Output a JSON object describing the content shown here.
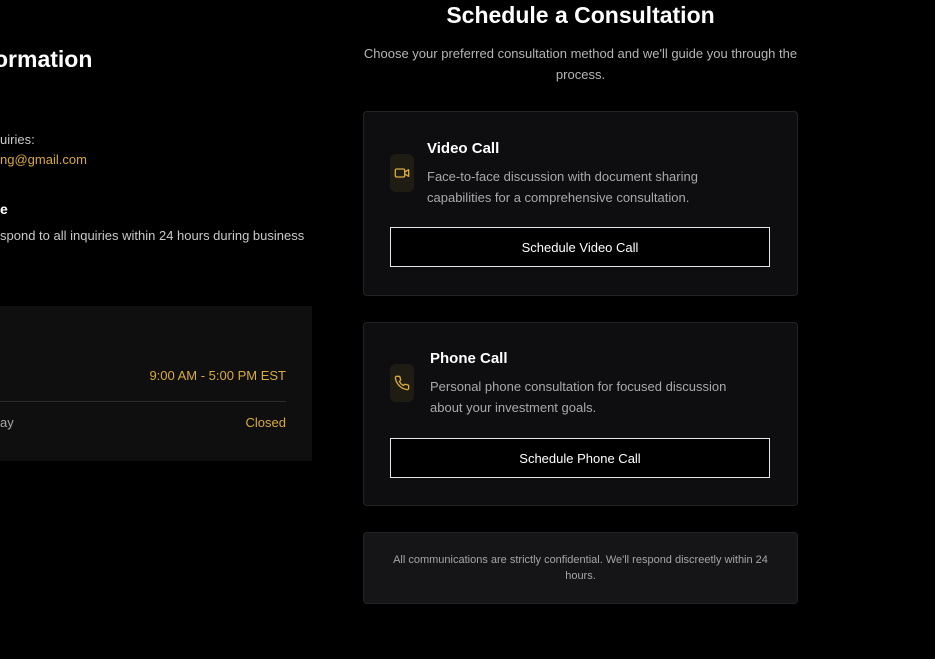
{
  "contact": {
    "title": "ormation",
    "inquiries_label": "uiries:",
    "email": "ng@gmail.com",
    "response_heading": "e",
    "response_text": "spond to all inquiries within 24 hours during business",
    "hours": [
      {
        "day": "",
        "time": "9:00 AM - 5:00 PM EST"
      },
      {
        "day": "ay",
        "time": "Closed"
      }
    ]
  },
  "consultation": {
    "heading": "Schedule a Consultation",
    "subheading": "Choose your preferred consultation method and we'll guide you through the process.",
    "video": {
      "title": "Video Call",
      "description": "Face-to-face discussion with document sharing capabilities for a comprehensive consultation.",
      "button_label": "Schedule Video Call",
      "icon": "video-camera-icon"
    },
    "phone": {
      "title": "Phone Call",
      "description": "Personal phone consultation for focused discussion about your investment goals.",
      "button_label": "Schedule Phone Call",
      "icon": "phone-icon"
    },
    "note": "All communications are strictly confidential. We'll respond discreetly within 24 hours."
  },
  "colors": {
    "background": "#000000",
    "card": "#0e0e10",
    "accent": "#d9aa3a",
    "text_muted": "#a9a9a9"
  }
}
